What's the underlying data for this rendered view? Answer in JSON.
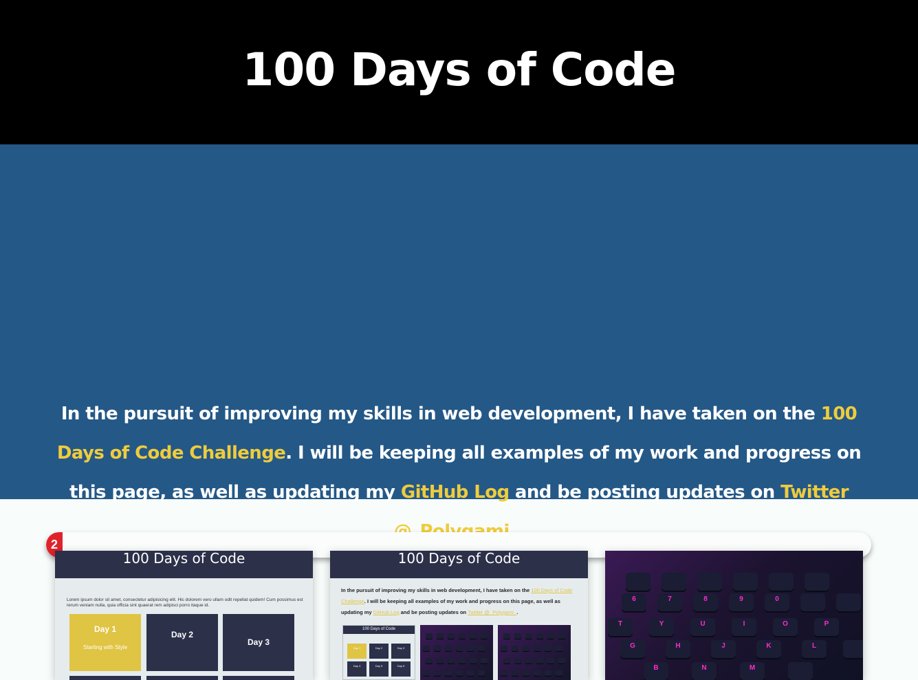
{
  "header": {
    "title": "100 Days of Code"
  },
  "intro": {
    "text_before": "In the pursuit of improving my skills in web development, I have taken on the ",
    "challenge_link": "100 Days of Code Challenge",
    "text_middle": ". I will be keeping all examples of my work and progress on this page, as well as updating my ",
    "github_link": "GitHub Log",
    "text_after": " and be posting updates on ",
    "twitter_link": "Twitter @_Polygami_",
    "text_end": "."
  },
  "progress": {
    "label": "2",
    "value_percent": 2,
    "color": "#e0232b"
  },
  "colors": {
    "header_bg": "#000000",
    "intro_bg": "#245887",
    "accent": "#efcc3d",
    "card_dark": "#2c3049"
  },
  "projects": [
    {
      "title": "100 Days of Code",
      "lorem": "Lorem ipsum dolor sit amet, consectetur adipisicing elit. Hic dolorem vero ullam odit repellat quidem! Cum possimus est rerum veniam nulla, quia officia sint quaerat rem adipisci porro itaque id.",
      "tiles": [
        {
          "label": "Day 1",
          "sub": "Starting with Style"
        },
        {
          "label": "Day 2",
          "sub": ""
        },
        {
          "label": "Day 3",
          "sub": ""
        }
      ]
    },
    {
      "title": "100 Days of Code",
      "text_before": "In the pursuit of improving my skills in web development, I have taken on the ",
      "challenge_link": "100 Days of Code Challenge",
      "text_middle": ". I will be keeping all examples of my work and progress on this page, as well as updating my ",
      "github_link": "GitHub Log",
      "text_after": " and be posting updates on ",
      "twitter_link": "Twitter @_Polygami_",
      "text_end": ".",
      "mini_title": "100 Days of Code",
      "mini_tiles": [
        "Day 1",
        "Day 2",
        "Day 3",
        "Day 4",
        "Day 5",
        "Day 6"
      ]
    },
    {
      "image": "keyboard-photo",
      "keys_row1": [
        "6",
        "7",
        "8",
        "9",
        "0"
      ],
      "keys_row2": [
        "T",
        "Y",
        "U",
        "I",
        "O",
        "P"
      ],
      "keys_row3": [
        "G",
        "H",
        "J",
        "K",
        "L"
      ],
      "keys_row4": [
        "B",
        "N",
        "M"
      ]
    }
  ]
}
